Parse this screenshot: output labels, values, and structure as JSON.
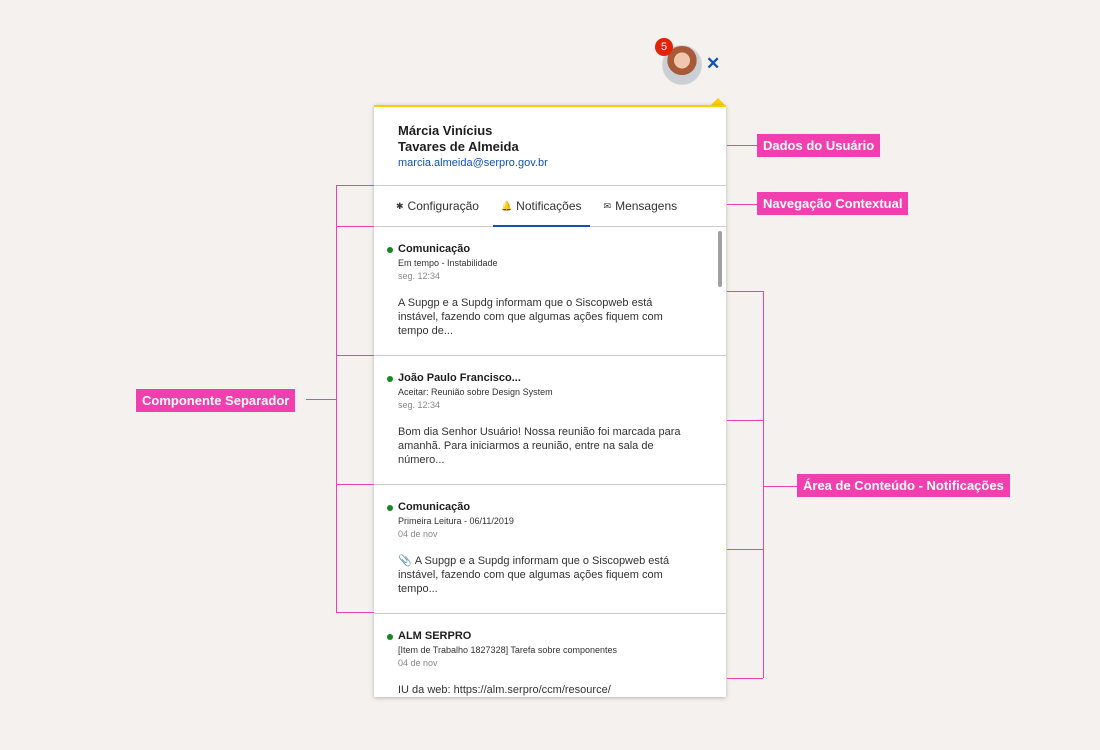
{
  "header": {
    "badge_count": "5",
    "close_icon": "close-icon"
  },
  "user": {
    "name_line1": "Márcia Vinícius",
    "name_line2": "Tavares de Almeida",
    "email": "marcia.almeida@serpro.gov.br"
  },
  "tabs": [
    {
      "label": "Configuração",
      "icon": "gear-icon",
      "glyph": "✱"
    },
    {
      "label": "Notificações",
      "icon": "bell-icon",
      "glyph": "🔔",
      "active": true
    },
    {
      "label": "Mensagens",
      "icon": "envelope-icon",
      "glyph": "✉"
    }
  ],
  "notifications": [
    {
      "title": "Comunicação",
      "subtitle": "Em tempo - Instabilidade",
      "time": "seg. 12:34",
      "body": "A Supgp e a Supdg informam que o Siscopweb está instável, fazendo com que algumas ações fiquem com tempo de..."
    },
    {
      "title": "João Paulo Francisco...",
      "subtitle": "Aceitar: Reunião sobre Design System",
      "time": "seg. 12:34",
      "body": "Bom dia Senhor Usuário!  Nossa reunião foi marcada para amanhã. Para iniciarmos a reunião, entre na sala de número..."
    },
    {
      "title": "Comunicação",
      "subtitle": "Primeira Leitura - 06/11/2019",
      "time": "04 de nov",
      "body": "A Supgp e a Supdg informam que o Siscopweb está instável, fazendo com que algumas ações fiquem com tempo..."
    },
    {
      "title": "ALM SERPRO",
      "subtitle": "[Item de Trabalho 1827328] Tarefa sobre componentes",
      "time": "04 de nov",
      "body": "IU da web: https://alm.serpro/ccm/resource/"
    }
  ],
  "annotations": {
    "user_data": "Dados do Usuário",
    "navigation": "Navegação Contextual",
    "separator": "Componente Separador",
    "content_area": "Área de Conteúdo - Notificações"
  },
  "colors": {
    "accent": "#1351b4",
    "annotation": "#f23fb0",
    "unread_dot": "#168821",
    "badge": "#e52207",
    "top_border": "#ffcd07"
  }
}
